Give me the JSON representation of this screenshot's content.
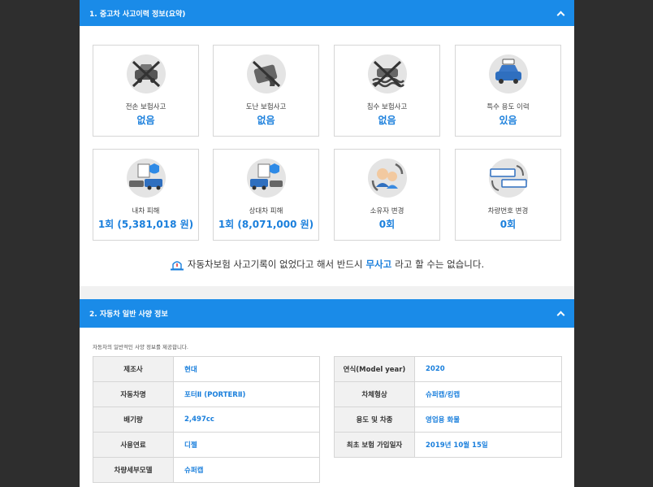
{
  "section1": {
    "title": "1. 중고차 사고이력 정보(요약)",
    "cards": [
      {
        "label": "전손 보험사고",
        "value": "없음",
        "icon": "car-crash-crossed-icon"
      },
      {
        "label": "도난 보험사고",
        "value": "없음",
        "icon": "car-theft-crossed-icon"
      },
      {
        "label": "침수 보험사고",
        "value": "없음",
        "icon": "car-flood-crossed-icon"
      },
      {
        "label": "특수 용도 이력",
        "value": "있음",
        "icon": "taxi-icon"
      },
      {
        "label": "내차 피해",
        "value": "1회 (5,381,018 원)",
        "icon": "my-car-damage-icon"
      },
      {
        "label": "상대차 피해",
        "value": "1회 (8,071,000 원)",
        "icon": "other-car-damage-icon"
      },
      {
        "label": "소유자 변경",
        "value": "0회",
        "icon": "owner-change-icon"
      },
      {
        "label": "차량번호 변경",
        "value": "0회",
        "icon": "plate-change-icon"
      }
    ],
    "notice": {
      "before": "자동차보험 사고기록이 없었다고 해서 반드시 ",
      "highlight": "무사고",
      "after": "라고 할 수는 없습니다."
    }
  },
  "section2": {
    "title": "2. 자동차 일반 사양 정보",
    "description": "자동차의 일반적인 사양 정보를 제공합니다.",
    "left_table": [
      {
        "key": "제조사",
        "value": "현대"
      },
      {
        "key": "자동차명",
        "value": "포터Ⅱ (PORTERⅡ)"
      },
      {
        "key": "배기량",
        "value": "2,497cc"
      },
      {
        "key": "사용연료",
        "value": "디젤"
      },
      {
        "key": "차량세부모델",
        "value": "슈퍼캡"
      }
    ],
    "right_table": [
      {
        "key": "연식(Model year)",
        "value": "2020"
      },
      {
        "key": "차체형상",
        "value": "슈퍼캡/킹캡"
      },
      {
        "key": "용도 및 차종",
        "value": "영업용 화물"
      },
      {
        "key": "최초 보험 가입일자",
        "value": "2019년 10월 15일"
      }
    ]
  },
  "colors": {
    "accent": "#1a8be8",
    "value_blue": "#1a7fdc",
    "background": "#2e2e2e"
  }
}
